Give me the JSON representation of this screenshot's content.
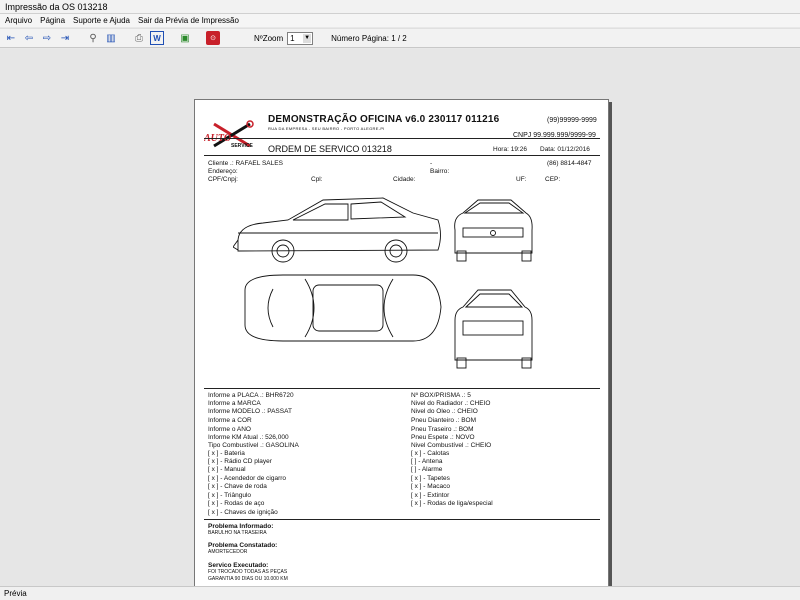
{
  "window": {
    "title": "Impressão da OS 013218"
  },
  "menu": [
    "Arquivo",
    "Página",
    "Suporte e Ajuda",
    "Sair da Prévia de Impressão"
  ],
  "toolbar": {
    "zoom_label": "NºZoom",
    "zoom_value": "1",
    "page_label": "Número Página: 1 / 2"
  },
  "header": {
    "company": "DEMONSTRAÇÃO OFICINA v6.0 230117 011216",
    "address": "RUA DA EMPRESA - SEU BAIRRO - PORTO ALEGRE-PI",
    "phone": "(99)99999-9999",
    "cnpj": "CNPJ 99.999.999/9999-99",
    "os_title": "ORDEM DE SERVICO 013218",
    "hora": "Hora: 19:26",
    "data": "Data: 01/12/2016",
    "logo_text": "AUTO SERVICE"
  },
  "client": {
    "cliente": "Cliente   .: RAFAEL SALES",
    "dash": "-",
    "phone": "(86) 8814-4847",
    "endereco": "Endereço:",
    "bairro": "Bairro:",
    "cpf": "CPF/Cnpj:",
    "cpl": "Cpl:",
    "cidade": "Cidade:",
    "uf": "UF:",
    "cep": "CEP:"
  },
  "vehicle_left": [
    "Informe a PLACA   .: BHR6720",
    "Informe a MARCA",
    "Informe MODELO .: PASSAT",
    "Informe a COR",
    "Informe o ANO",
    "Informe KM Atual  .:     526,000",
    "Tipo Combustível  .: GASOLINA"
  ],
  "vehicle_right": [
    "Nº BOX/PRISMA   .: 5",
    "Nivel do Radiador .: CHEIO",
    "Nivel do Oleo       .: CHEIO",
    "Pneu Dianteiro     .: BOM",
    "Pneu Traseiro      .: BOM",
    "Pneu Espete        .: NOVO",
    "Nivel Combustível .: CHEIO"
  ],
  "checks_left": [
    "[ x ] - Bateria",
    "[ x ] - Rádio CD player",
    "[ x ] - Manual",
    "[ x ] - Acendedor de cigarro",
    "[ x ] - Chave de roda",
    "[ x ] - Triângulo",
    "[ x ] - Rodas de aço",
    "[ x ] - Chaves de ignição"
  ],
  "checks_right": [
    "[ x ] - Calotas",
    "[    ] - Antena",
    "[    ] - Alarme",
    "[ x ] - Tapetes",
    "[ x ] - Macaco",
    "[ x ] - Extintor",
    "[ x ] - Rodas de liga/especial"
  ],
  "problems": {
    "informado_h": "Problema Informado:",
    "informado_t": "BARULHO NA TRASEIRA",
    "constatado_h": "Problema Constatado:",
    "constatado_t": "AMORTECEDOR",
    "servico_h": "Servico Executado:",
    "servico_t1": "FOI TROCADO TODAS AS PEÇAS",
    "servico_t2": "GARANTIA 90 DIAS OU 10.000 KM"
  },
  "status": "Prévia"
}
